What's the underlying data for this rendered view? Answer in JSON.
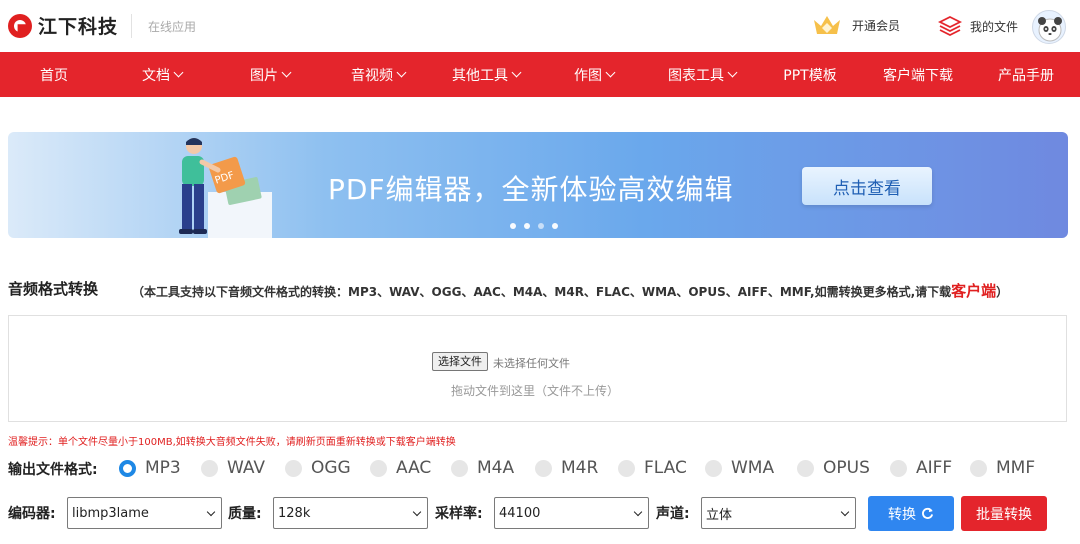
{
  "header": {
    "brand": "江下科技",
    "sub": "在线应用",
    "vip_label": "开通会员",
    "files_label": "我的文件"
  },
  "nav": {
    "items": [
      {
        "label": "首页",
        "dropdown": false
      },
      {
        "label": "文档",
        "dropdown": true
      },
      {
        "label": "图片",
        "dropdown": true
      },
      {
        "label": "音视频",
        "dropdown": true
      },
      {
        "label": "其他工具",
        "dropdown": true
      },
      {
        "label": "作图",
        "dropdown": true
      },
      {
        "label": "图表工具",
        "dropdown": true
      },
      {
        "label": "PPT模板",
        "dropdown": false
      },
      {
        "label": "客户端下载",
        "dropdown": false
      },
      {
        "label": "产品手册",
        "dropdown": false
      }
    ]
  },
  "banner": {
    "title": "PDF编辑器，全新体验高效编辑",
    "button": "点击查看",
    "illustration_text": "PDF"
  },
  "tool": {
    "title": "音频格式转换",
    "note_prefix": "（本工具支持以下音频文件格式的转换：MP3、WAV、OGG、AAC、M4A、M4R、FLAC、WMA、OPUS、AIFF、MMF,如需转换更多格式,请下载",
    "note_link": "客户端",
    "note_suffix": "）"
  },
  "upload": {
    "choose_button": "选择文件",
    "no_file": "未选择任何文件",
    "drop_tip": "拖动文件到这里（文件不上传）"
  },
  "warning": "温馨提示：单个文件尽量小于100MB,如转换大音频文件失败，请刷新页面重新转换或下载客户端转换",
  "formats": {
    "label": "输出文件格式:",
    "options": [
      "MP3",
      "WAV",
      "OGG",
      "AAC",
      "M4A",
      "M4R",
      "FLAC",
      "WMA",
      "OPUS",
      "AIFF",
      "MMF"
    ],
    "selected": "MP3"
  },
  "controls": {
    "encoder_label": "编码器:",
    "encoder_value": "libmp3lame",
    "quality_label": "质量:",
    "quality_value": "128k",
    "rate_label": "采样率:",
    "rate_value": "44100",
    "channel_label": "声道:",
    "channel_value": "立体",
    "convert_button": "转换",
    "batch_button": "批量转换"
  },
  "colors": {
    "brand_red": "#e4252c",
    "primary_blue": "#2f86f0"
  }
}
